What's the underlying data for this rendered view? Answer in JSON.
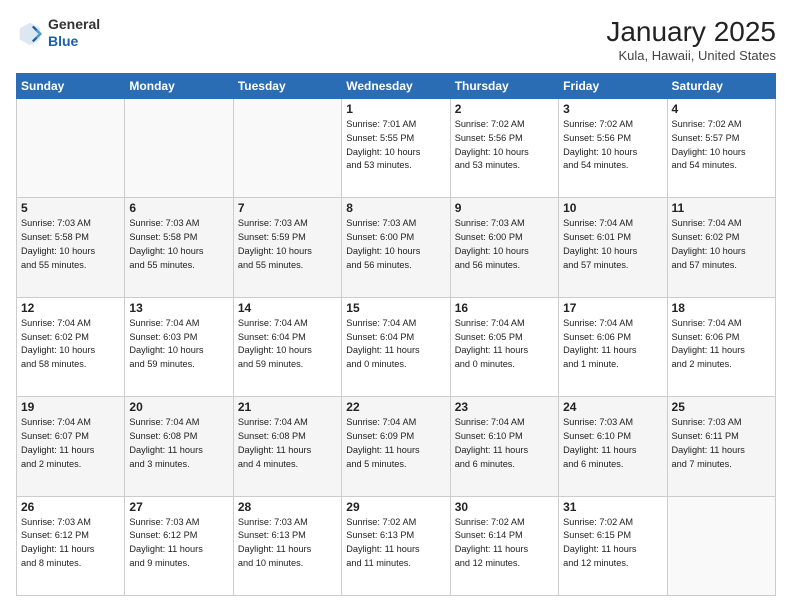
{
  "header": {
    "logo_line1": "General",
    "logo_line2": "Blue",
    "month": "January 2025",
    "location": "Kula, Hawaii, United States"
  },
  "days_of_week": [
    "Sunday",
    "Monday",
    "Tuesday",
    "Wednesday",
    "Thursday",
    "Friday",
    "Saturday"
  ],
  "weeks": [
    [
      {
        "day": "",
        "info": ""
      },
      {
        "day": "",
        "info": ""
      },
      {
        "day": "",
        "info": ""
      },
      {
        "day": "1",
        "info": "Sunrise: 7:01 AM\nSunset: 5:55 PM\nDaylight: 10 hours\nand 53 minutes."
      },
      {
        "day": "2",
        "info": "Sunrise: 7:02 AM\nSunset: 5:56 PM\nDaylight: 10 hours\nand 53 minutes."
      },
      {
        "day": "3",
        "info": "Sunrise: 7:02 AM\nSunset: 5:56 PM\nDaylight: 10 hours\nand 54 minutes."
      },
      {
        "day": "4",
        "info": "Sunrise: 7:02 AM\nSunset: 5:57 PM\nDaylight: 10 hours\nand 54 minutes."
      }
    ],
    [
      {
        "day": "5",
        "info": "Sunrise: 7:03 AM\nSunset: 5:58 PM\nDaylight: 10 hours\nand 55 minutes."
      },
      {
        "day": "6",
        "info": "Sunrise: 7:03 AM\nSunset: 5:58 PM\nDaylight: 10 hours\nand 55 minutes."
      },
      {
        "day": "7",
        "info": "Sunrise: 7:03 AM\nSunset: 5:59 PM\nDaylight: 10 hours\nand 55 minutes."
      },
      {
        "day": "8",
        "info": "Sunrise: 7:03 AM\nSunset: 6:00 PM\nDaylight: 10 hours\nand 56 minutes."
      },
      {
        "day": "9",
        "info": "Sunrise: 7:03 AM\nSunset: 6:00 PM\nDaylight: 10 hours\nand 56 minutes."
      },
      {
        "day": "10",
        "info": "Sunrise: 7:04 AM\nSunset: 6:01 PM\nDaylight: 10 hours\nand 57 minutes."
      },
      {
        "day": "11",
        "info": "Sunrise: 7:04 AM\nSunset: 6:02 PM\nDaylight: 10 hours\nand 57 minutes."
      }
    ],
    [
      {
        "day": "12",
        "info": "Sunrise: 7:04 AM\nSunset: 6:02 PM\nDaylight: 10 hours\nand 58 minutes."
      },
      {
        "day": "13",
        "info": "Sunrise: 7:04 AM\nSunset: 6:03 PM\nDaylight: 10 hours\nand 59 minutes."
      },
      {
        "day": "14",
        "info": "Sunrise: 7:04 AM\nSunset: 6:04 PM\nDaylight: 10 hours\nand 59 minutes."
      },
      {
        "day": "15",
        "info": "Sunrise: 7:04 AM\nSunset: 6:04 PM\nDaylight: 11 hours\nand 0 minutes."
      },
      {
        "day": "16",
        "info": "Sunrise: 7:04 AM\nSunset: 6:05 PM\nDaylight: 11 hours\nand 0 minutes."
      },
      {
        "day": "17",
        "info": "Sunrise: 7:04 AM\nSunset: 6:06 PM\nDaylight: 11 hours\nand 1 minute."
      },
      {
        "day": "18",
        "info": "Sunrise: 7:04 AM\nSunset: 6:06 PM\nDaylight: 11 hours\nand 2 minutes."
      }
    ],
    [
      {
        "day": "19",
        "info": "Sunrise: 7:04 AM\nSunset: 6:07 PM\nDaylight: 11 hours\nand 2 minutes."
      },
      {
        "day": "20",
        "info": "Sunrise: 7:04 AM\nSunset: 6:08 PM\nDaylight: 11 hours\nand 3 minutes."
      },
      {
        "day": "21",
        "info": "Sunrise: 7:04 AM\nSunset: 6:08 PM\nDaylight: 11 hours\nand 4 minutes."
      },
      {
        "day": "22",
        "info": "Sunrise: 7:04 AM\nSunset: 6:09 PM\nDaylight: 11 hours\nand 5 minutes."
      },
      {
        "day": "23",
        "info": "Sunrise: 7:04 AM\nSunset: 6:10 PM\nDaylight: 11 hours\nand 6 minutes."
      },
      {
        "day": "24",
        "info": "Sunrise: 7:03 AM\nSunset: 6:10 PM\nDaylight: 11 hours\nand 6 minutes."
      },
      {
        "day": "25",
        "info": "Sunrise: 7:03 AM\nSunset: 6:11 PM\nDaylight: 11 hours\nand 7 minutes."
      }
    ],
    [
      {
        "day": "26",
        "info": "Sunrise: 7:03 AM\nSunset: 6:12 PM\nDaylight: 11 hours\nand 8 minutes."
      },
      {
        "day": "27",
        "info": "Sunrise: 7:03 AM\nSunset: 6:12 PM\nDaylight: 11 hours\nand 9 minutes."
      },
      {
        "day": "28",
        "info": "Sunrise: 7:03 AM\nSunset: 6:13 PM\nDaylight: 11 hours\nand 10 minutes."
      },
      {
        "day": "29",
        "info": "Sunrise: 7:02 AM\nSunset: 6:13 PM\nDaylight: 11 hours\nand 11 minutes."
      },
      {
        "day": "30",
        "info": "Sunrise: 7:02 AM\nSunset: 6:14 PM\nDaylight: 11 hours\nand 12 minutes."
      },
      {
        "day": "31",
        "info": "Sunrise: 7:02 AM\nSunset: 6:15 PM\nDaylight: 11 hours\nand 12 minutes."
      },
      {
        "day": "",
        "info": ""
      }
    ]
  ]
}
